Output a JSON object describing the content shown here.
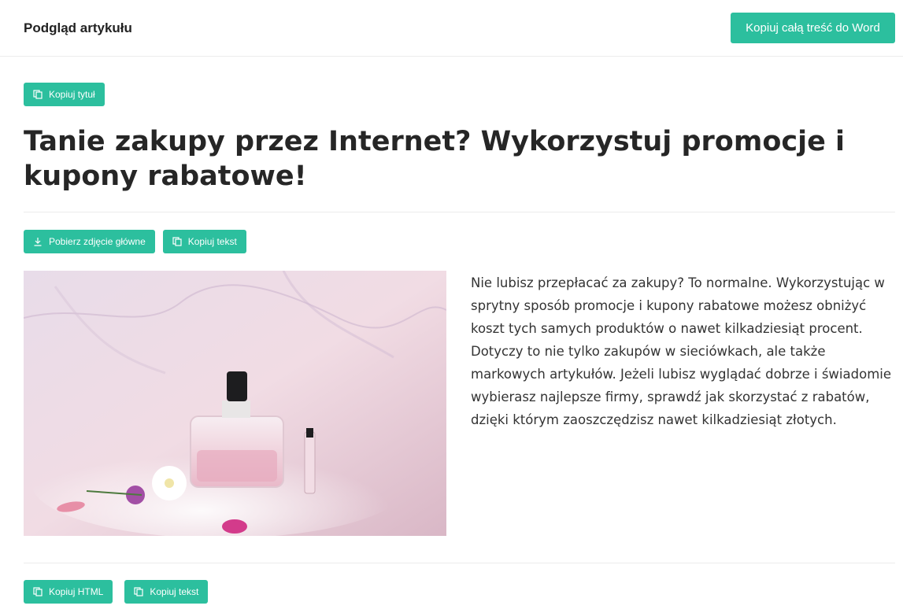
{
  "header": {
    "title": "Podgląd artykułu",
    "copy_word_label": "Kopiuj całą treść do Word"
  },
  "actions": {
    "copy_title_label": "Kopiuj tytuł",
    "download_image_label": "Pobierz zdjęcie główne",
    "copy_text_label": "Kopiuj tekst",
    "copy_html_label": "Kopiuj HTML",
    "copy_text_bottom_label": "Kopiuj tekst"
  },
  "article": {
    "title": "Tanie zakupy przez Internet? Wykorzystuj promocje i kupony rabatowe!",
    "lead": "Nie lubisz przepłacać za zakupy? To normalne. Wykorzystując w sprytny sposób promocje i kupony rabatowe możesz obniżyć koszt tych samych produktów o nawet kilkadziesiąt procent. Dotyczy to nie tylko zakupów w sieciówkach, ale także markowych artykułów. Jeżeli lubisz wyglądać dobrze i świadomie wybierasz najlepsze firmy, sprawdź jak skorzystać z rabatów, dzięki którym zaoszczędzisz nawet kilkadziesiąt złotych."
  },
  "colors": {
    "accent": "#2cbf9e",
    "text": "#262626",
    "divider": "#ececec"
  },
  "icons": {
    "copy": "copy-icon",
    "download": "download-icon"
  }
}
